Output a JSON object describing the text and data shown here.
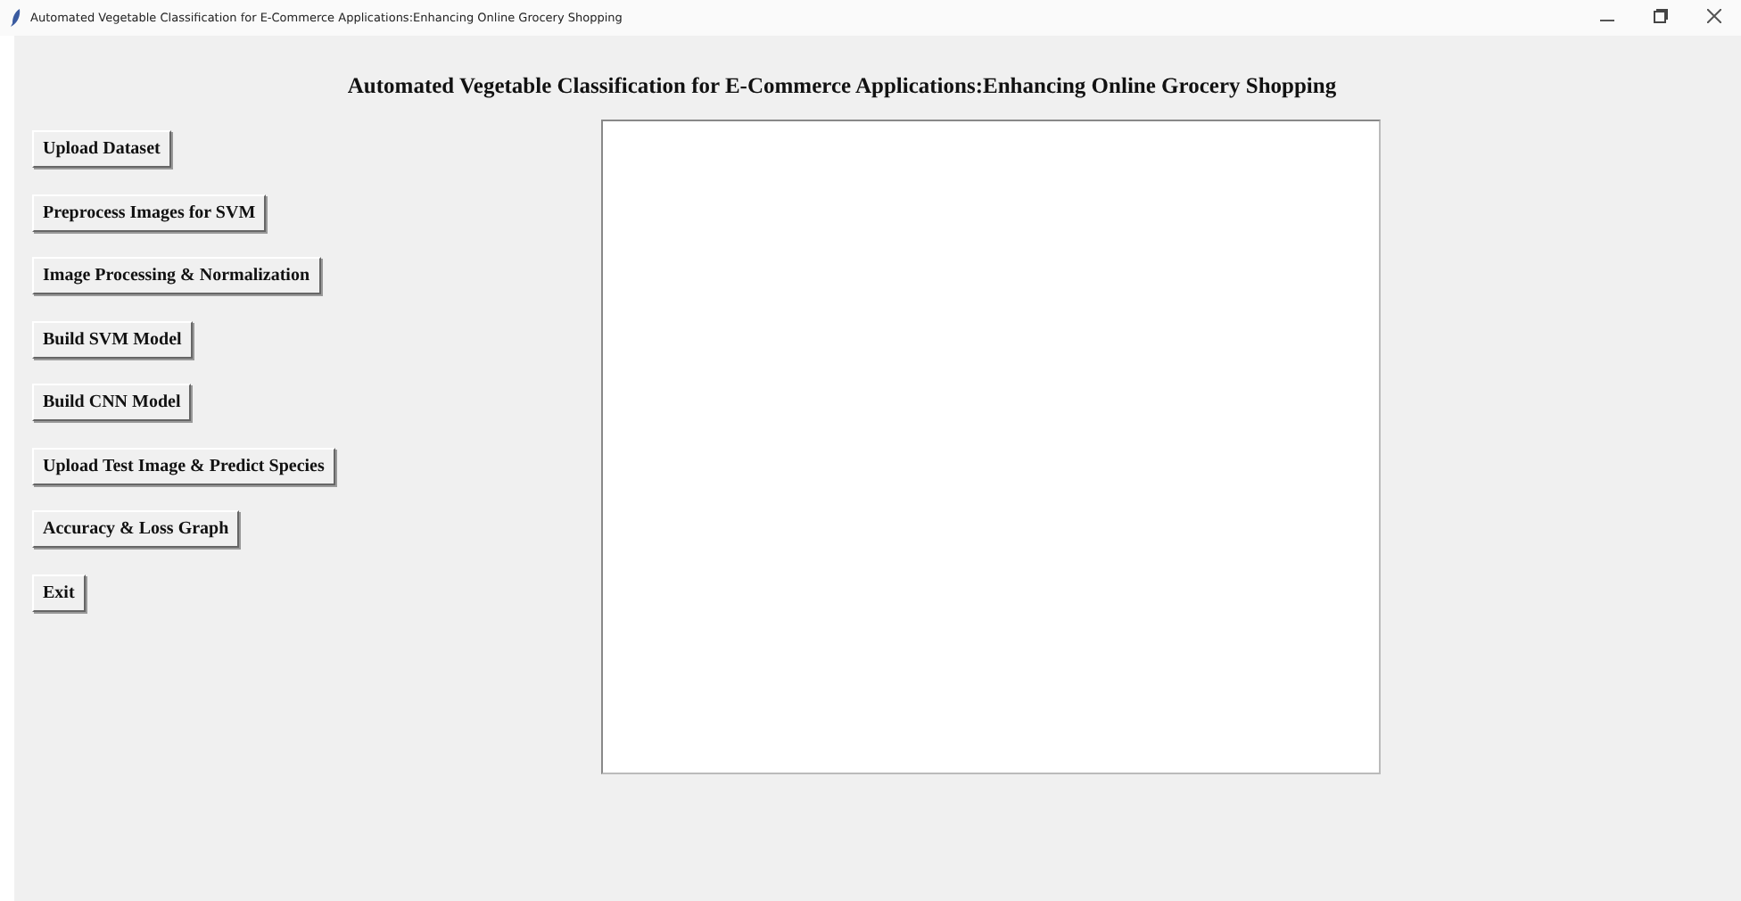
{
  "window": {
    "title": "Automated Vegetable Classification for E-Commerce Applications:Enhancing Online Grocery Shopping"
  },
  "heading": "Automated Vegetable Classification for E-Commerce Applications:Enhancing Online Grocery Shopping",
  "buttons": [
    "Upload Dataset",
    "Preprocess Images for SVM",
    "Image Processing & Normalization",
    "Build SVM Model",
    "Build CNN Model",
    "Upload Test Image & Predict Species",
    "Accuracy & Loss Graph",
    "Exit"
  ],
  "output": {
    "kind": "text-area"
  }
}
